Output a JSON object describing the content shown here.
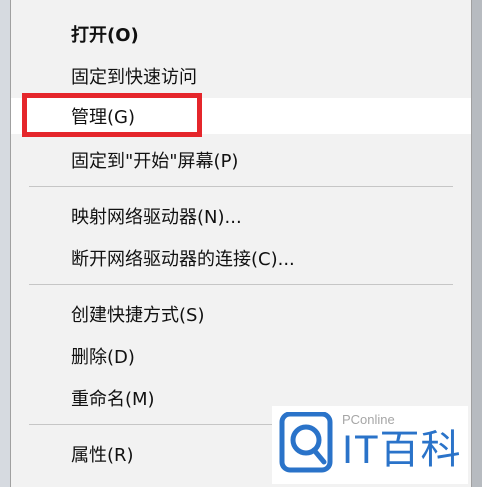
{
  "menu": {
    "items": [
      {
        "label": "打开(O)"
      },
      {
        "label": "固定到快速访问"
      },
      {
        "label": "管理(G)"
      },
      {
        "label": "固定到\"开始\"屏幕(P)"
      },
      {
        "label": "映射网络驱动器(N)..."
      },
      {
        "label": "断开网络驱动器的连接(C)..."
      },
      {
        "label": "创建快捷方式(S)"
      },
      {
        "label": "删除(D)"
      },
      {
        "label": "重命名(M)"
      },
      {
        "label": "属性(R)"
      }
    ]
  },
  "watermark": {
    "small_text": "PConline",
    "brand_text": "IT百科",
    "icon": "magnifier-logo-icon"
  },
  "colors": {
    "highlight_box": "#e5262b",
    "brand_blue": "#2a73c9"
  }
}
